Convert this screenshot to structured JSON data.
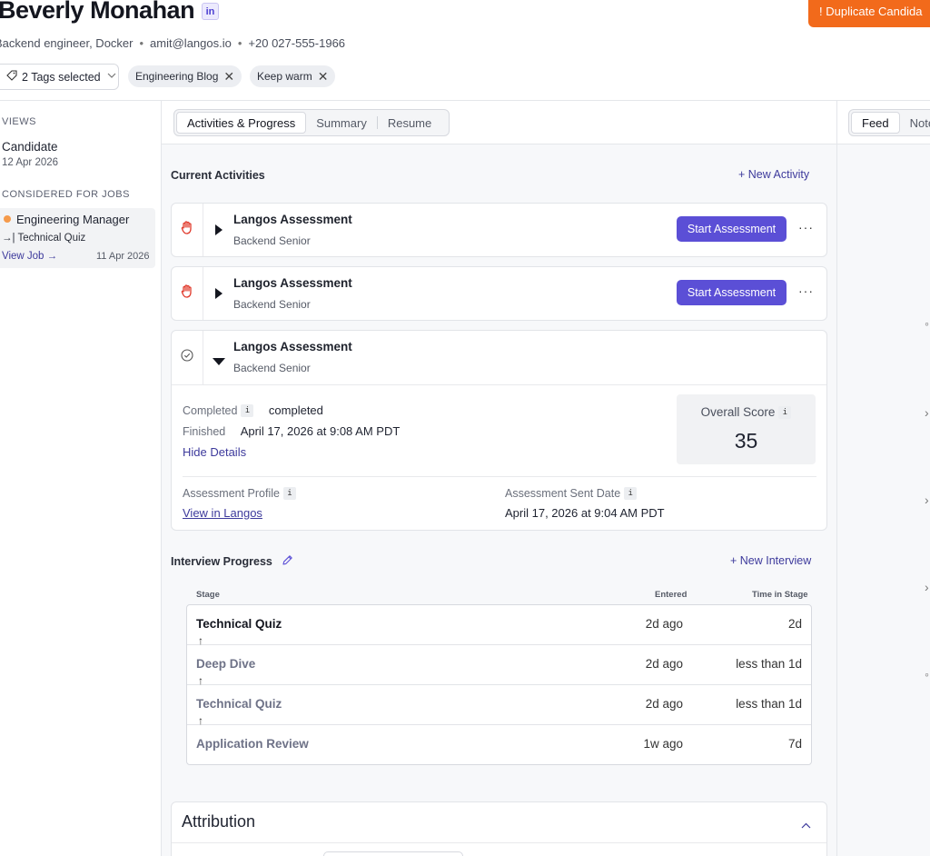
{
  "header": {
    "name": "Beverly Monahan",
    "linkedin_glyph": "in",
    "duplicate_label": "! Duplicate Candida",
    "subtitle": {
      "role": "Backend engineer, Docker",
      "email": "amit@langos.io",
      "phone": "+20 027-555-1966",
      "separator": "•"
    },
    "tags_select": "2 Tags selected",
    "tags": [
      "Engineering Blog",
      "Keep warm"
    ]
  },
  "sidebar": {
    "views_caption": "VIEWS",
    "view_name": "Candidate",
    "view_date": "12 Apr 2026",
    "jobs_caption": "CONSIDERED FOR JOBS",
    "job_title": "Engineering Manager",
    "job_stage": "Technical Quiz",
    "view_job_label": "View Job →",
    "job_date": "11 Apr 2026",
    "status_color": "#f59a4b"
  },
  "main": {
    "tabs": [
      "Activities & Progress",
      "Summary",
      "Resume"
    ],
    "current_activities_title": "Current Activities",
    "new_activity_label": "+ New Activity",
    "activities": [
      {
        "name": "Langos Assessment",
        "sub": "Backend Senior",
        "action": "Start Assessment",
        "icon": "hand-icon"
      },
      {
        "name": "Langos Assessment",
        "sub": "Backend Senior",
        "action": "Start Assessment",
        "icon": "hand-icon"
      }
    ],
    "expanded": {
      "name": "Langos Assessment",
      "sub": "Backend Senior",
      "completed_label": "Completed",
      "completed_value": "completed",
      "finished_label": "Finished",
      "finished_value": "April 17, 2026 at 9:08 AM PDT",
      "hide_details": "Hide Details",
      "score_label": "Overall Score",
      "score_value": "35",
      "profile_label": "Assessment Profile",
      "profile_link": "View in Langos",
      "sent_label": "Assessment Sent Date",
      "sent_value": "April 17, 2026 at 9:04 AM PDT"
    },
    "interview_title": "Interview Progress",
    "new_interview_label": "+ New Interview",
    "table_headers": {
      "stage": "Stage",
      "entered": "Entered",
      "time": "Time in Stage"
    },
    "stages": [
      {
        "name": "Technical Quiz",
        "entered": "2d ago",
        "time": "2d"
      },
      {
        "name": "Deep Dive",
        "entered": "2d ago",
        "time": "less than 1d"
      },
      {
        "name": "Technical Quiz",
        "entered": "2d ago",
        "time": "less than 1d"
      },
      {
        "name": "Application Review",
        "entered": "1w ago",
        "time": "7d"
      }
    ],
    "attribution_title": "Attribution"
  },
  "right_panel": {
    "tabs": [
      "Feed",
      "Note"
    ]
  },
  "colors": {
    "accent": "#5b4fd6",
    "warning": "#f26a1b",
    "hand_red": "#e0382a",
    "link": "#3d3a9c"
  }
}
